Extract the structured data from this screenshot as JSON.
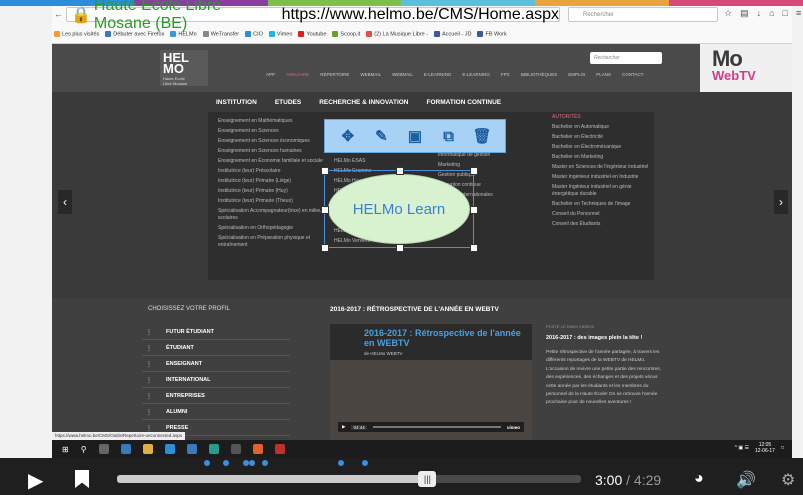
{
  "colors": {
    "topbar": [
      "#2a8fd8",
      "#8a3fa0",
      "#7cc04a",
      "#5bc0de",
      "#e8a33c",
      "#d64a7a"
    ],
    "accent": "#3b8fe0",
    "webtv_pink": "#d23c8a"
  },
  "browser": {
    "url_site": "Haute Ecole Libre Mosane (BE)",
    "url": "https://www.helmo.be/CMS/Home.aspx",
    "search_placeholder": "Rechercher",
    "bookmarks": [
      "Les plus visités",
      "Débuter avec Firefox",
      "HELMo",
      "WeTransfer",
      "CIO",
      "Vimeo",
      "Youtube",
      "Scoop.it",
      "(2) La Musique Libre -",
      "Accueil - JD",
      "FB Work"
    ]
  },
  "site": {
    "logo_main": "HEL\nMO",
    "logo_sub": "Haute Ecole\nLibre Mosane",
    "search_placeholder": "Rechercher",
    "webtv_mo": "Mo",
    "webtv_tv": "WebTV",
    "topnav": [
      "APP",
      "ANNUAIRE",
      "RÉPERTOIRE",
      "WEBMAIL",
      "WEBMAIL",
      "E-LEARNING",
      "E-LEARNING",
      "FPC",
      "BIBLIOTHÈQUES",
      "EMPLOI",
      "PLANS",
      "CONTACT"
    ],
    "mainnav": [
      "INSTITUTION",
      "ETUDES",
      "RECHERCHE & INNOVATION",
      "FORMATION CONTINUE"
    ],
    "col1": [
      "Enseignement en Mathématiques",
      "Enseignement en Sciences",
      "Enseignement en Sciences économiques",
      "Enseignement en Sciences humaines",
      "Enseignement en Économie familiale et sociale",
      "Institutrice (teur) Préscolaire",
      "Institutrice (teur) Primaire (Liège)",
      "Institutrice (teur) Primaire (Huy)",
      "Institutrice (teur) Primaire (Theux)",
      "Spécialisation Accompagnateur(trice) en milieux scolaires",
      "Spécialisation en Orthopédagogie",
      "Spécialisation en Préparation physique et entraînement"
    ],
    "col2": [
      "HELMo Ste-Julienne",
      "HELMo ESAS",
      "HELMo Gramme",
      "HELMo Huy",
      "HELMo Mode",
      "HELMo Saint-Laurent",
      "HELMo Saint-Martin",
      "HELMo Saint-Roch",
      "HELMo Sainte-Croix",
      "HELMo Verviers"
    ],
    "col3": [
      "Ingénieur",
      "Informatique",
      "Informatique de gestion",
      "Marketing",
      "Gestion publique",
      "Formation continue",
      "Relations internationales",
      "Travaux et fin"
    ],
    "col4_title": "AUTORITÉS",
    "col4": [
      "Bachelier en Automatique",
      "Bachelier en Électricité",
      "Bachelier en Électromécanique",
      "Bachelier en Marketing",
      "Master en Sciences de l'ingénieur industriel",
      "Master Ingénieur industriel en Industrie",
      "Master Ingénieur industriel en génie énergétique durable",
      "Bachelier en Techniques de l'image",
      "Conseil du Personnel",
      "Conseil des Étudiants"
    ]
  },
  "editor": {
    "tools": [
      "move-tool",
      "pen-tool",
      "bring-front-tool",
      "duplicate-tool",
      "delete-tool"
    ],
    "ellipse_label": "HELMo Learn"
  },
  "lower": {
    "profile_title": "CHOISISSEZ VOTRE PROFIL",
    "profiles": [
      "FUTUR ÉTUDIANT",
      "ÉTUDIANT",
      "ENSEIGNANT",
      "INTERNATIONAL",
      "ENTREPRISES",
      "ALUMNI",
      "PRESSE"
    ],
    "retro_title": "2016-2017 : RÉTROSPECTIVE DE L'ANNÉE EN WEBTV",
    "video_title": "2016-2017 : Rétrospective de l'année en WEBTV",
    "video_from": "de HELMo WEBTV",
    "video_time": "04:44",
    "video_brand": "vimeo",
    "news_small": "POSTÉ LE DANS VIDÉOS",
    "news_head": "2016-2017 : des images plein la tête !",
    "news_body": "Petite rétrospective de l'année partagée, à travers les différents reportages de la WEBTV de HELMo. L'occasion de revivre une petite partie des rencontres, des expériences, des échanges et des projets vécus cette année par les étudiants et les membres du personnel de la Haute École! On se retrouve l'année prochaine pour de nouvelles aventures !",
    "status_url": "https://www.helmo.be/CMS/Outils/Repertoire-unconnected.aspx"
  },
  "taskbar": {
    "time": "12:05",
    "date": "12-06-17"
  },
  "player": {
    "current_time": "3:00",
    "separator": " / ",
    "duration": "4:29",
    "progress": 0.669,
    "markers": [
      0.194,
      0.235,
      0.277,
      0.292,
      0.318,
      0.483,
      0.534
    ]
  }
}
